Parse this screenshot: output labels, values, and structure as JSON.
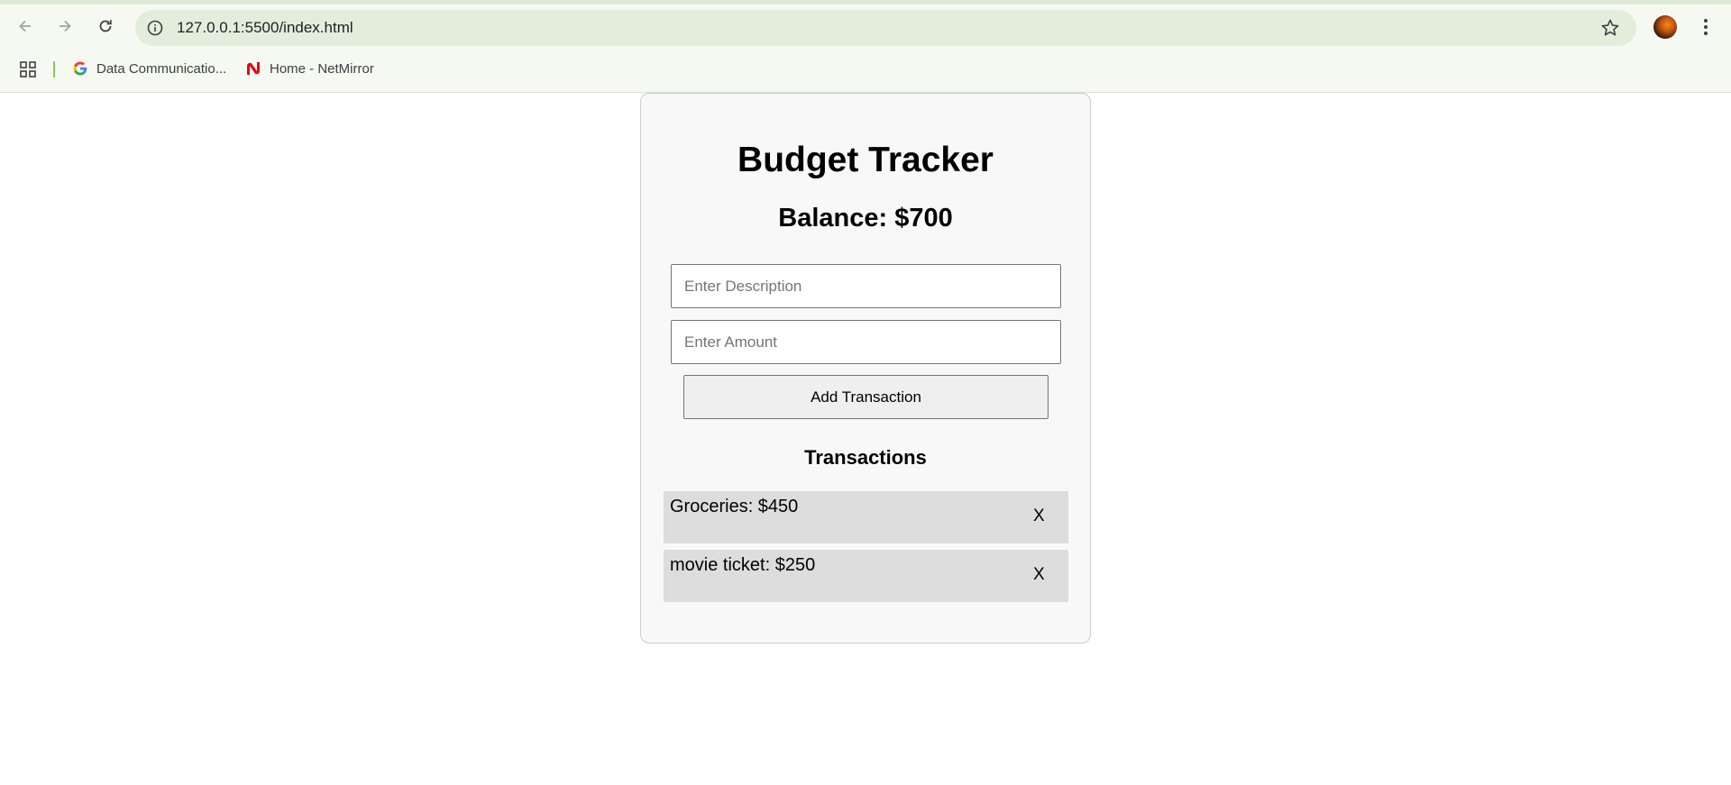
{
  "browser": {
    "url": "127.0.0.1:5500/index.html",
    "bookmarks": [
      {
        "label": "Data Communicatio...",
        "icon": "google-icon"
      },
      {
        "label": "Home - NetMirror",
        "icon": "netmirror-icon"
      }
    ]
  },
  "app": {
    "title": "Budget Tracker",
    "balance": "Balance: $700",
    "description_placeholder": "Enter Description",
    "amount_placeholder": "Enter Amount",
    "add_button_label": "Add Transaction",
    "transactions_heading": "Transactions",
    "transactions": [
      {
        "text": "Groceries: $450",
        "delete_label": "X"
      },
      {
        "text": "movie ticket: $250",
        "delete_label": "X"
      }
    ]
  }
}
